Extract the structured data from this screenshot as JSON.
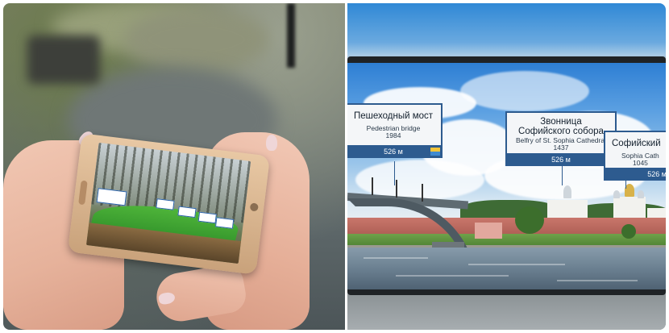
{
  "ar_labels": [
    {
      "title": "Пешеходный мост",
      "subtitle": "Pedestrian bridge",
      "year": "1984",
      "distance": "526 м"
    },
    {
      "title_line1": "Звонница",
      "title_line2": "Софийского собора",
      "subtitle": "Belfry of St. Sophia Cathedral",
      "year": "1437",
      "distance": "526 м"
    },
    {
      "title": "Софийский",
      "subtitle": "Sophia Cath",
      "year": "1045",
      "distance": "526 м"
    }
  ],
  "colors": {
    "label_bar": "#2d5b8f",
    "label_bg": "#f4f6f8",
    "ar_terrain_green": "#4fb53a"
  },
  "icons": [
    "city-crest-icon"
  ]
}
